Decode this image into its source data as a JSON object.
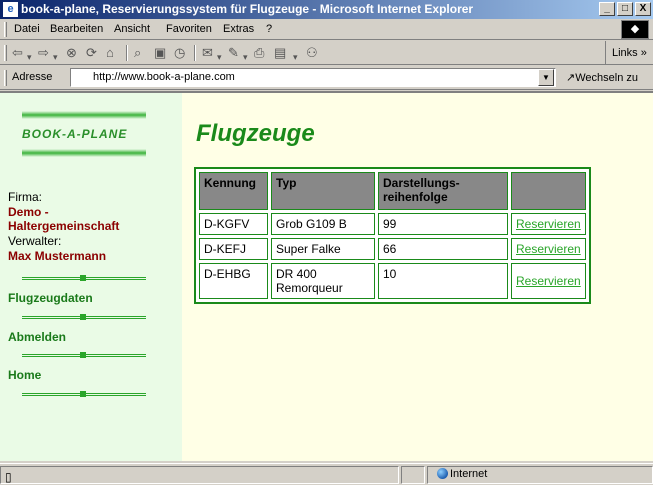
{
  "window": {
    "title": "book-a-plane, Reservierungssystem für Flugzeuge - Microsoft Internet Explorer",
    "min": "_",
    "max": "□",
    "close": "X"
  },
  "menu": {
    "items": [
      {
        "label": "Datei"
      },
      {
        "label": "Bearbeiten"
      },
      {
        "label": "Ansicht"
      },
      {
        "label": "Favoriten"
      },
      {
        "label": "Extras"
      },
      {
        "label": "?"
      }
    ]
  },
  "toolbar": {
    "links_label": "Links »"
  },
  "address": {
    "label": "Adresse",
    "url": "http://www.book-a-plane.com",
    "go_label": "Wechseln zu"
  },
  "sidebar": {
    "logo_text": "BOOK-A-PLANE",
    "firma_label": "Firma:",
    "firma_value_1": "Demo -",
    "firma_value_2": "Haltergemeinschaft",
    "verwalter_label": "Verwalter:",
    "verwalter_value": "Max Mustermann",
    "links": [
      {
        "label": "Flugzeugdaten"
      },
      {
        "label": "Abmelden"
      },
      {
        "label": "Home"
      }
    ]
  },
  "main": {
    "title": "Flugzeuge",
    "table": {
      "headers": [
        "Kennung",
        "Typ",
        "Darstellungs-reihenfolge",
        ""
      ],
      "header_line1": "Darstellungs-",
      "header_line2": "reihenfolge",
      "rows": [
        {
          "kennung": "D-KGFV",
          "typ": "Grob G109 B",
          "reihenfolge": "99",
          "action": "Reservieren"
        },
        {
          "kennung": "D-KEFJ",
          "typ": "Super Falke",
          "reihenfolge": "66",
          "action": "Reservieren"
        },
        {
          "kennung": "D-EHBG",
          "typ_line1": "DR 400",
          "typ_line2": "Remorqueur",
          "reihenfolge": "10",
          "action": "Reservieren"
        }
      ]
    }
  },
  "status": {
    "zone": "Internet"
  },
  "colors": {
    "accent_green": "#1a8a1a",
    "link_green": "#2aa52a",
    "sidebar_bg": "#eafbe6",
    "content_bg": "#ffffe6",
    "name_red": "#8b0000"
  }
}
